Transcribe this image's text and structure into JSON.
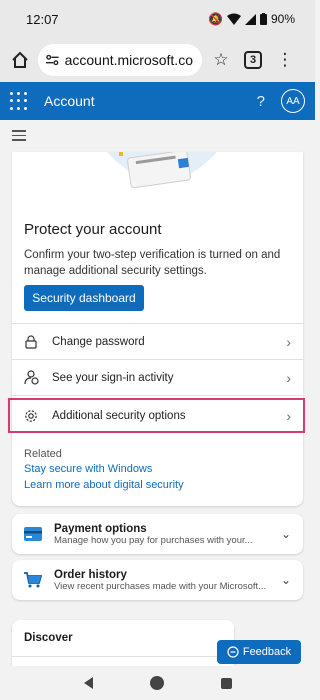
{
  "status_bar": {
    "time": "12:07",
    "battery": "90%"
  },
  "browser": {
    "url": "account.microsoft.com/",
    "tab_count": "3"
  },
  "header": {
    "title": "Account",
    "help": "?",
    "avatar_initials": "AA"
  },
  "protect": {
    "title": "Protect your account",
    "description": "Confirm your two-step verification is turned on and manage additional security settings.",
    "dashboard_button": "Security dashboard",
    "rows": [
      {
        "label": "Change password"
      },
      {
        "label": "See your sign-in activity"
      },
      {
        "label": "Additional security options"
      }
    ],
    "related_label": "Related",
    "links": [
      "Stay secure with Windows",
      "Learn more about digital security"
    ]
  },
  "payment": {
    "title": "Payment options",
    "subtitle": "Manage how you pay for purchases with your..."
  },
  "orders": {
    "title": "Order history",
    "subtitle": "View recent purchases made with your Microsoft..."
  },
  "discover": {
    "title": "Discover"
  },
  "feedback": {
    "label": "Feedback"
  },
  "colors": {
    "brand": "#0f6cbd",
    "highlight": "#d9396b"
  }
}
